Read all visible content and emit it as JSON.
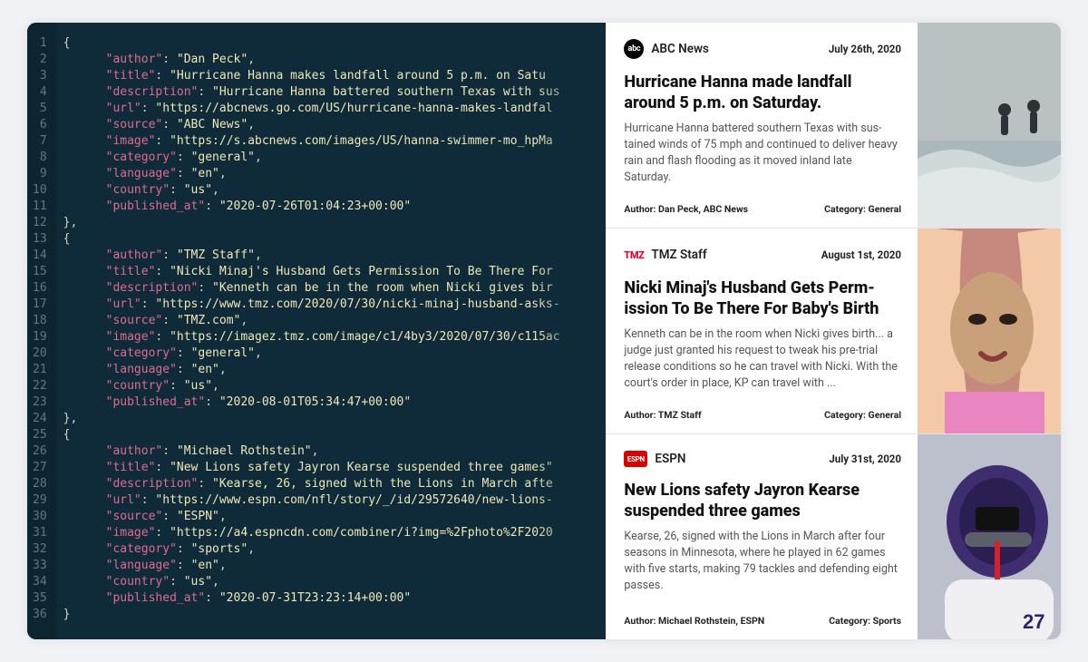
{
  "code_lines": [
    {
      "n": 1,
      "ind": 0,
      "txt": "{"
    },
    {
      "n": 2,
      "ind": 1,
      "key": "author",
      "val": "Dan Peck",
      "comma": true
    },
    {
      "n": 3,
      "ind": 1,
      "key": "title",
      "val": "Hurricane Hanna makes landfall around 5 p.m. on Satu",
      "comma": true,
      "fade": true
    },
    {
      "n": 4,
      "ind": 1,
      "key": "description",
      "val": "Hurricane Hanna battered southern Texas with sus",
      "comma": true,
      "fade": true
    },
    {
      "n": 5,
      "ind": 1,
      "key": "url",
      "val": "https://abcnews.go.com/US/hurricane-hanna-makes-landfal",
      "comma": true,
      "fade": true
    },
    {
      "n": 6,
      "ind": 1,
      "key": "source",
      "val": "ABC News",
      "comma": true
    },
    {
      "n": 7,
      "ind": 1,
      "key": "image",
      "val": "https://s.abcnews.com/images/US/hanna-swimmer-mo_hpMa",
      "comma": true,
      "fade": true
    },
    {
      "n": 8,
      "ind": 1,
      "key": "category",
      "val": "general",
      "comma": true
    },
    {
      "n": 9,
      "ind": 1,
      "key": "language",
      "val": "en",
      "comma": true
    },
    {
      "n": 10,
      "ind": 1,
      "key": "country",
      "val": "us",
      "comma": true
    },
    {
      "n": 11,
      "ind": 1,
      "key": "published_at",
      "val": "2020-07-26T01:04:23+00:00"
    },
    {
      "n": 12,
      "ind": 0,
      "txt": "},"
    },
    {
      "n": 13,
      "ind": 0,
      "txt": "{"
    },
    {
      "n": 14,
      "ind": 1,
      "key": "author",
      "val": "TMZ Staff",
      "comma": true
    },
    {
      "n": 15,
      "ind": 1,
      "key": "title",
      "val": "Nicki Minaj's Husband Gets Permission To Be There For",
      "comma": true,
      "fade": true
    },
    {
      "n": 16,
      "ind": 1,
      "key": "description",
      "val": "Kenneth can be in the room when Nicki gives bir",
      "comma": true,
      "fade": true
    },
    {
      "n": 17,
      "ind": 1,
      "key": "url",
      "val": "https://www.tmz.com/2020/07/30/nicki-minaj-husband-asks-",
      "comma": true,
      "fade": true
    },
    {
      "n": 18,
      "ind": 1,
      "key": "source",
      "val": "TMZ.com",
      "comma": true
    },
    {
      "n": 19,
      "ind": 1,
      "key": "image",
      "val": "https://imagez.tmz.com/image/c1/4by3/2020/07/30/c115ac",
      "comma": true,
      "fade": true
    },
    {
      "n": 20,
      "ind": 1,
      "key": "category",
      "val": "general",
      "comma": true
    },
    {
      "n": 21,
      "ind": 1,
      "key": "language",
      "val": "en",
      "comma": true
    },
    {
      "n": 22,
      "ind": 1,
      "key": "country",
      "val": "us",
      "comma": true
    },
    {
      "n": 23,
      "ind": 1,
      "key": "published_at",
      "val": "2020-08-01T05:34:47+00:00"
    },
    {
      "n": 24,
      "ind": 0,
      "txt": "},"
    },
    {
      "n": 25,
      "ind": 0,
      "txt": "{"
    },
    {
      "n": 26,
      "ind": 1,
      "key": "author",
      "val": "Michael Rothstein",
      "comma": true
    },
    {
      "n": 27,
      "ind": 1,
      "key": "title",
      "val": "New Lions safety Jayron Kearse suspended three games\"",
      "comma": true,
      "fade": true
    },
    {
      "n": 28,
      "ind": 1,
      "key": "description",
      "val": "Kearse, 26, signed with the Lions in March afte",
      "comma": true,
      "fade": true
    },
    {
      "n": 29,
      "ind": 1,
      "key": "url",
      "val": "https://www.espn.com/nfl/story/_/id/29572640/new-lions-",
      "comma": true,
      "fade": true
    },
    {
      "n": 30,
      "ind": 1,
      "key": "source",
      "val": "ESPN",
      "comma": true
    },
    {
      "n": 31,
      "ind": 1,
      "key": "image",
      "val": "https://a4.espncdn.com/combiner/i?img=%2Fphoto%2F2020",
      "comma": true,
      "fade": true
    },
    {
      "n": 32,
      "ind": 1,
      "key": "category",
      "val": "sports",
      "comma": true
    },
    {
      "n": 33,
      "ind": 1,
      "key": "language",
      "val": "en",
      "comma": true
    },
    {
      "n": 34,
      "ind": 1,
      "key": "country",
      "val": "us",
      "comma": true
    },
    {
      "n": 35,
      "ind": 1,
      "key": "published_at",
      "val": "2020-07-31T23:23:14+00:00"
    },
    {
      "n": 36,
      "ind": 0,
      "txt": "}"
    }
  ],
  "cards": [
    {
      "logo_class": "abc",
      "logo_text": "abc",
      "source": "ABC News",
      "date": "July 26th, 2020",
      "title": "Hurricane Hanna made landfall around 5 p.m. on Saturday.",
      "desc": "Hurricane Hanna battered southern Texas with sus-\ntained winds of 75 mph and continued to deliver heavy rain and flash flooding as it moved inland late Saturday.",
      "author": "Author: Dan Peck, ABC News",
      "category": "Category: General"
    },
    {
      "logo_class": "tmz",
      "logo_text": "TMZ",
      "source": "TMZ Staff",
      "date": "August 1st, 2020",
      "title": "Nicki Minaj's Husband Gets Perm-ission To Be There For Baby's Birth",
      "desc": "Kenneth can be in the room when Nicki gives birth... a judge just granted his request to tweak his pre-trial release conditions so he can travel with Nicki. With the court's order in place, KP can travel with ...",
      "author": "Author: TMZ Staff",
      "category": "Category: General"
    },
    {
      "logo_class": "espn",
      "logo_text": "ESPN",
      "source": "ESPN",
      "date": "July 31st, 2020",
      "title": "New Lions safety Jayron Kearse suspended three games",
      "desc": "Kearse, 26, signed with the Lions in March after four seasons in Minnesota, where he played in 62 games with five starts, making 79 tackles and defending eight passes.",
      "author": "Author: Michael Rothstein, ESPN",
      "category": "Category: Sports"
    }
  ]
}
